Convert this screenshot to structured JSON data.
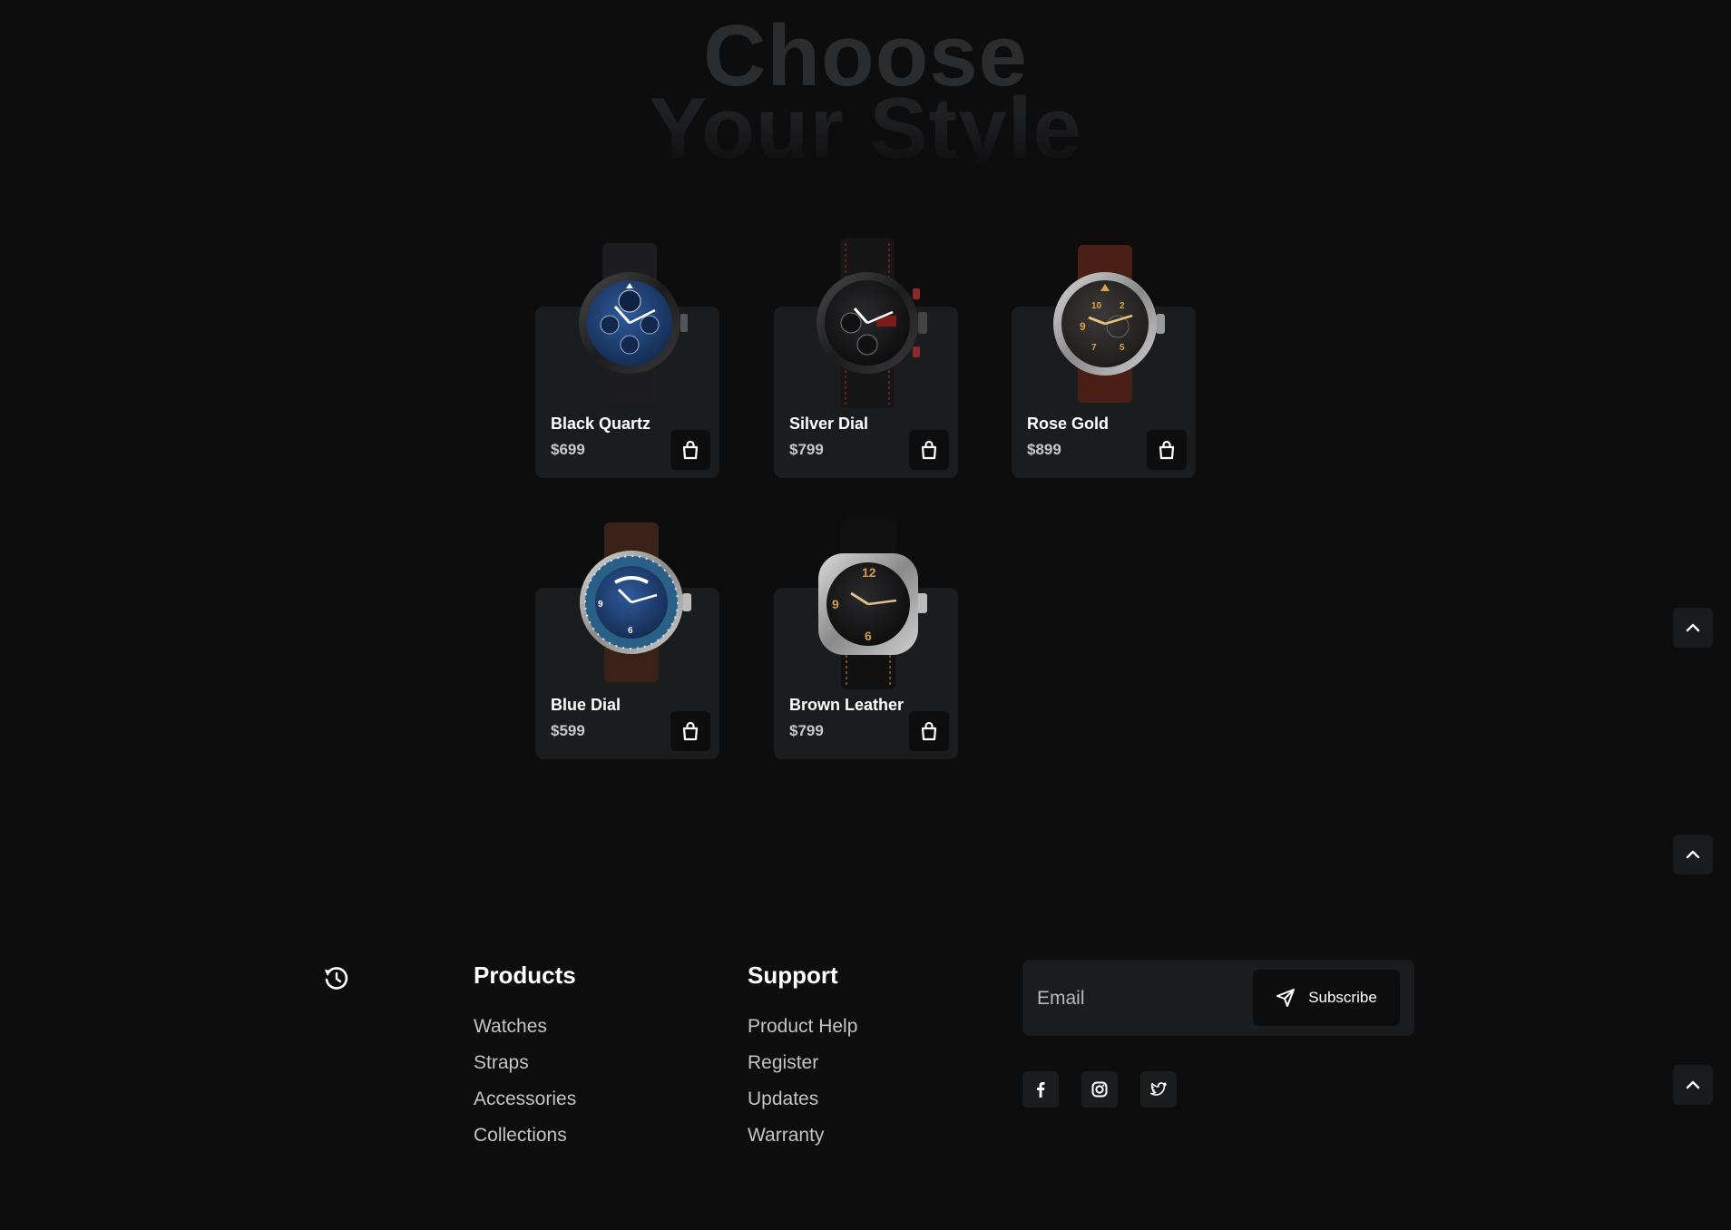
{
  "hero": {
    "line1": "Choose",
    "line2": "Your Style"
  },
  "products": [
    {
      "name": "Black Quartz",
      "price": "$699",
      "image": "blue-dial-moonphase-watch"
    },
    {
      "name": "Silver Dial",
      "price": "$799",
      "image": "black-chronograph-watch"
    },
    {
      "name": "Rose Gold",
      "price": "$899",
      "image": "pilot-watch-brown-strap"
    },
    {
      "name": "Blue Dial",
      "price": "$599",
      "image": "blue-bezel-worldtimer-watch"
    },
    {
      "name": "Brown Leather",
      "price": "$799",
      "image": "cushion-case-black-watch"
    }
  ],
  "footer": {
    "products": {
      "title": "Products",
      "links": [
        "Watches",
        "Straps",
        "Accessories",
        "Collections"
      ]
    },
    "support": {
      "title": "Support",
      "links": [
        "Product Help",
        "Register",
        "Updates",
        "Warranty"
      ]
    },
    "newsletter": {
      "placeholder": "Email",
      "button": "Subscribe"
    },
    "social": [
      "facebook-icon",
      "instagram-icon",
      "twitter-icon"
    ]
  },
  "colors": {
    "background": "#0d0d0e",
    "card": "#1b1c1e",
    "accent_gold": "#d9a441"
  }
}
